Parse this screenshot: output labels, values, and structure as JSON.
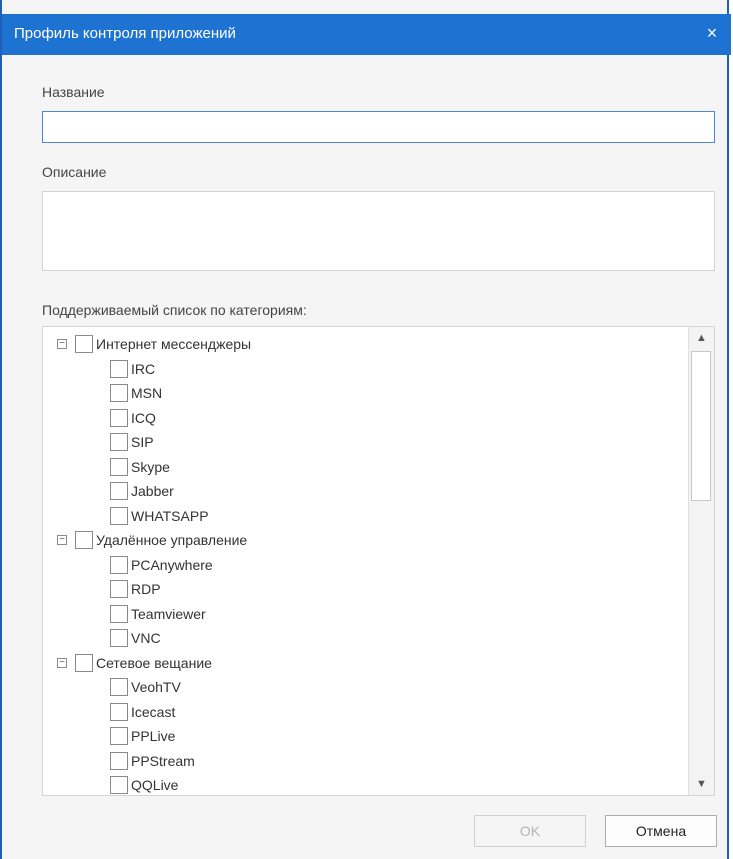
{
  "window": {
    "title": "Профиль контроля приложений",
    "close_glyph": "×"
  },
  "fields": {
    "name_label": "Название",
    "name_value": "",
    "description_label": "Описание",
    "description_value": ""
  },
  "tree": {
    "label": "Поддерживаемый список по категориям:",
    "categories": [
      {
        "label": "Интернет мессенджеры",
        "expanded": true,
        "checked": false,
        "items": [
          "IRC",
          "MSN",
          "ICQ",
          "SIP",
          "Skype",
          "Jabber",
          "WHATSAPP"
        ]
      },
      {
        "label": "Удалённое управление",
        "expanded": true,
        "checked": false,
        "items": [
          "PCAnywhere",
          "RDP",
          "Teamviewer",
          "VNC"
        ]
      },
      {
        "label": "Сетевое вещание",
        "expanded": true,
        "checked": false,
        "items": [
          "VeohTV",
          "Icecast",
          "PPLive",
          "PPStream",
          "QQLive"
        ]
      }
    ],
    "expander_glyph": "−",
    "scroll_up_glyph": "▲",
    "scroll_down_glyph": "▼"
  },
  "buttons": {
    "ok_label": "OK",
    "cancel_label": "Отмена"
  },
  "colors": {
    "titlebar": "#1e73d2",
    "border": "#1f5fb8",
    "input_focus": "#4b88d4"
  }
}
